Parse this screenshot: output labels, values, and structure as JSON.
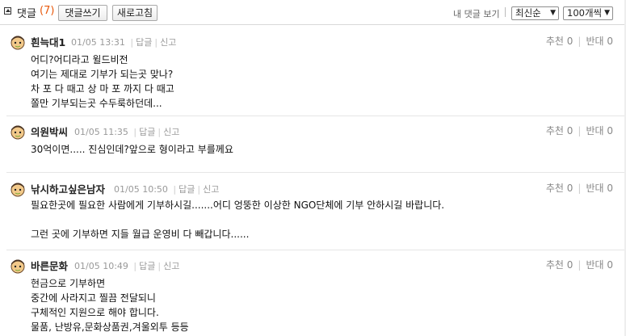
{
  "toolbar": {
    "title": "댓글",
    "count": "(7)",
    "write_label": "댓글쓰기",
    "refresh_label": "새로고침",
    "my_comments_label": "내 댓글 보기",
    "sort_value": "최신순",
    "page_size_value": "100개씩"
  },
  "comments": [
    {
      "author": "흰늑대1",
      "datetime": "01/05 13:31",
      "reply": "답글",
      "report": "신고",
      "recommend": "추천 0",
      "oppose": "반대 0",
      "body": "어디?어디라고 윌드비전\n여기는 제대로 기부가 되는곳 맞나?\n차 포 다 때고 상 마 포 까지 다 때고\n쫄만 기부되는곳 수두룩하던데..."
    },
    {
      "author": "의원박씨",
      "datetime": "01/05 11:35",
      "reply": "답글",
      "report": "신고",
      "recommend": "추천 0",
      "oppose": "반대 0",
      "body": "30억이면..... 진심인데?앞으로 형이라고 부를께요"
    },
    {
      "author": "낚시하고싶은남자",
      "datetime": "01/05 10:50",
      "reply": "답글",
      "report": "신고",
      "recommend": "추천 0",
      "oppose": "반대 0",
      "body": "필요한곳에 필요한 사람에게 기부하시길.......어디 엉뚱한 이상한 NGO단체에 기부 안하시길 바랍니다.\n\n그런 곳에 기부하면 지들 월급 운영비 다 빼갑니다......"
    },
    {
      "author": "바른문화",
      "datetime": "01/05 10:49",
      "reply": "답글",
      "report": "신고",
      "recommend": "추천 0",
      "oppose": "반대 0",
      "body": "현금으로 기부하면\n중간에 사라지고 찔끔 전달되니\n구체적인 지원으로 해야 합니다.\n물품, 난방유,문화상품권,겨울외투 등등"
    }
  ]
}
